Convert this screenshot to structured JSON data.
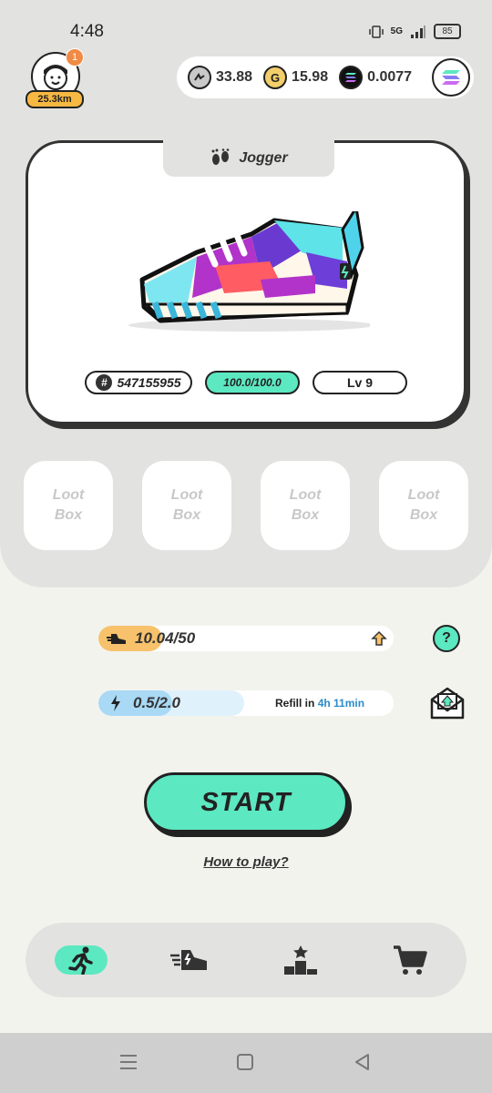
{
  "status_bar": {
    "time": "4:48",
    "network": "5G",
    "battery": "85"
  },
  "profile": {
    "distance": "25.3km",
    "notification_count": "1"
  },
  "balances": [
    {
      "name": "GST",
      "icon": "gst-coin-icon",
      "value": "33.88",
      "color": "#c9c9c9"
    },
    {
      "name": "GMT",
      "icon": "gmt-coin-icon",
      "value": "15.98",
      "color": "#f2cf6a"
    },
    {
      "name": "SOL",
      "icon": "sol-coin-icon",
      "value": "0.0077",
      "color": "#111111"
    }
  ],
  "sneaker": {
    "type": "Jogger",
    "id": "547155955",
    "durability": "100.0/100.0",
    "durability_fraction": 1.0,
    "level": "Lv 9"
  },
  "loot_boxes": [
    {
      "line1": "Loot",
      "line2": "Box"
    },
    {
      "line1": "Loot",
      "line2": "Box"
    },
    {
      "line1": "Loot",
      "line2": "Box"
    },
    {
      "line1": "Loot",
      "line2": "Box"
    }
  ],
  "stamina": {
    "value": "10.04/50",
    "fraction": 0.2008
  },
  "energy": {
    "value": "0.5/2.0",
    "fraction": 0.25,
    "refill_label": "Refill in",
    "refill_time": "4h 11min"
  },
  "actions": {
    "start": "START",
    "how_to_play": "How to play?"
  },
  "colors": {
    "accent": "#5ce8c1",
    "stamina": "#f7c26b",
    "energy": "#a9d9f5",
    "energy_bg": "#dff1fb"
  },
  "nav": [
    {
      "name": "run",
      "icon": "running-person-icon",
      "active": true
    },
    {
      "name": "sneakers",
      "icon": "sneaker-icon",
      "active": false
    },
    {
      "name": "ranking",
      "icon": "podium-icon",
      "active": false
    },
    {
      "name": "shop",
      "icon": "shopping-cart-icon",
      "active": false
    }
  ]
}
